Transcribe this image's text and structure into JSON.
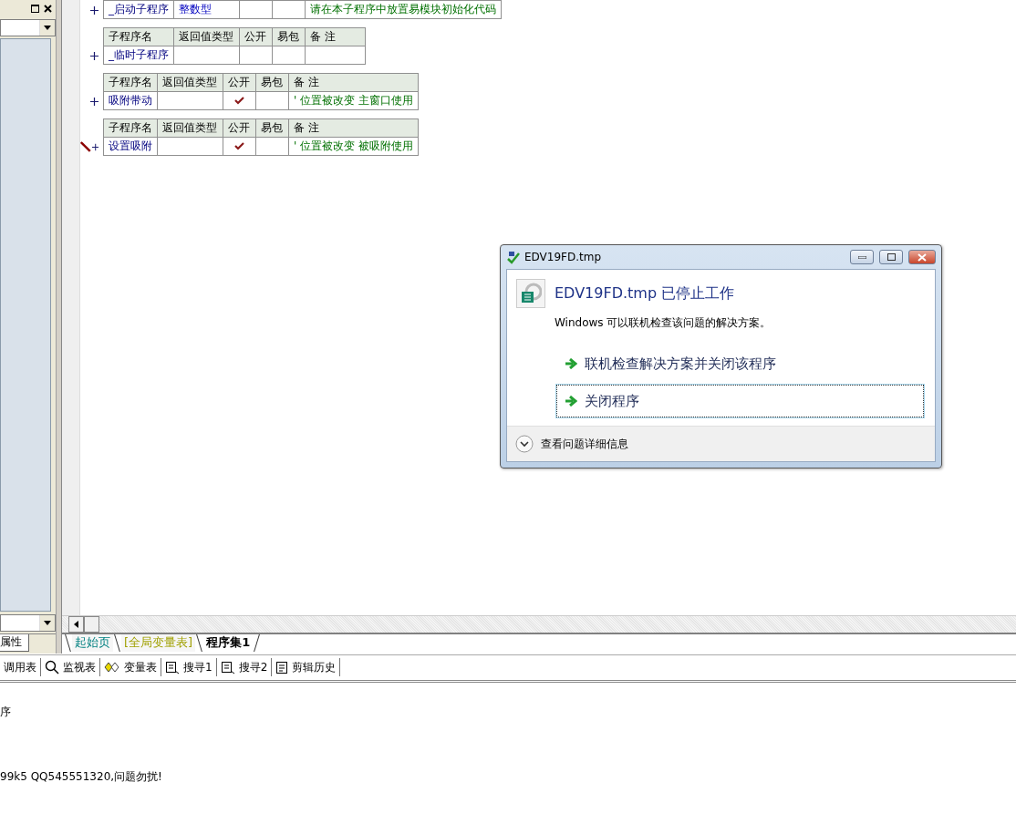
{
  "left_panel": {
    "tab": "属性"
  },
  "subroutines": [
    {
      "name": "_启动子程序",
      "return_type": "整数型",
      "public": false,
      "current": false,
      "note": "请在本子程序中放置易模块初始化代码"
    },
    {
      "columns": [
        "子程序名",
        "返回值类型",
        "公开",
        "易包",
        "备 注"
      ],
      "name": "_临时子程序",
      "public": false,
      "current": false
    },
    {
      "columns": [
        "子程序名",
        "返回值类型",
        "公开",
        "易包",
        "备 注"
      ],
      "name": "吸附带动",
      "public": true,
      "current": false,
      "note": "' 位置被改变  主窗口使用"
    },
    {
      "columns": [
        "子程序名",
        "返回值类型",
        "公开",
        "易包",
        "备 注"
      ],
      "name": "设置吸附",
      "public": true,
      "current": true,
      "note": "' 位置被改变  被吸附使用"
    }
  ],
  "editor_tabs": [
    {
      "label": "起始页",
      "color": "#008080",
      "selected": false
    },
    {
      "label": "[全局变量表]",
      "color": "#a0a000",
      "selected": false
    },
    {
      "label": "程序集1",
      "color": "#000000",
      "selected": true
    }
  ],
  "toolbar": [
    {
      "kind": "none",
      "label": "调用表"
    },
    {
      "kind": "magnifier",
      "label": "监视表"
    },
    {
      "kind": "variables",
      "label": "变量表"
    },
    {
      "kind": "find",
      "label": "搜寻1"
    },
    {
      "kind": "find",
      "label": "搜寻2"
    },
    {
      "kind": "clipboard",
      "label": "剪辑历史"
    }
  ],
  "output_lines": [
    "序",
    "99k5 QQ545551320,问题勿扰!"
  ],
  "dialog": {
    "title": "EDV19FD.tmp",
    "heading": "EDV19FD.tmp 已停止工作",
    "message": "Windows 可以联机检查该问题的解决方案。",
    "options": [
      {
        "label": "联机检查解决方案并关闭该程序",
        "selected": false
      },
      {
        "label": "关闭程序",
        "selected": true
      }
    ],
    "details": "查看问题详细信息"
  }
}
